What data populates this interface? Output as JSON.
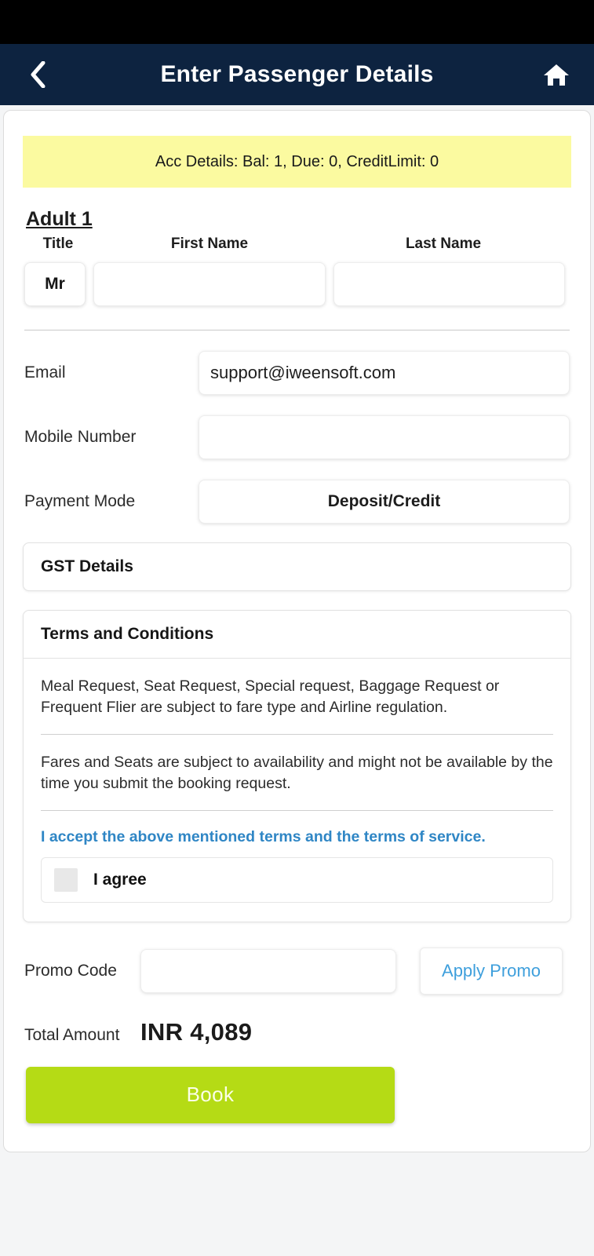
{
  "appbar": {
    "title": "Enter Passenger Details",
    "back_icon": "chevron-left-icon",
    "home_icon": "home-icon"
  },
  "account_banner": {
    "text": "Acc Details: Bal: 1, Due: 0, CreditLimit: 0",
    "background_color": "#fbfaa0"
  },
  "passenger": {
    "heading": "Adult 1",
    "labels": {
      "title": "Title",
      "first_name": "First Name",
      "last_name": "Last Name"
    },
    "title_value": "Mr",
    "first_name_value": "",
    "last_name_value": "",
    "first_name_placeholder": "",
    "last_name_placeholder": ""
  },
  "contact": {
    "email_label": "Email",
    "email_value": "support@iweensoft.com",
    "mobile_label": "Mobile Number",
    "mobile_value": "",
    "mobile_placeholder": "",
    "payment_label": "Payment Mode",
    "payment_value": "Deposit/Credit"
  },
  "gst": {
    "header": "GST Details"
  },
  "terms": {
    "header": "Terms and Conditions",
    "paragraphs": [
      "Meal Request, Seat Request, Special request, Baggage Request or Frequent Flier are subject to fare type and Airline regulation.",
      "Fares and Seats are subject to availability and might not be available by the time you submit the booking request."
    ],
    "accept_link": "I accept the above mentioned terms and the terms of service.",
    "agree_label": "I agree",
    "agree_checked": false,
    "link_color": "#2f86c5"
  },
  "promo": {
    "label": "Promo Code",
    "value": "",
    "placeholder": "",
    "apply_label": "Apply Promo",
    "apply_color": "#3e9fdc"
  },
  "total": {
    "label": "Total Amount",
    "value": "INR 4,089"
  },
  "book": {
    "label": "Book",
    "color": "#b5db15"
  }
}
